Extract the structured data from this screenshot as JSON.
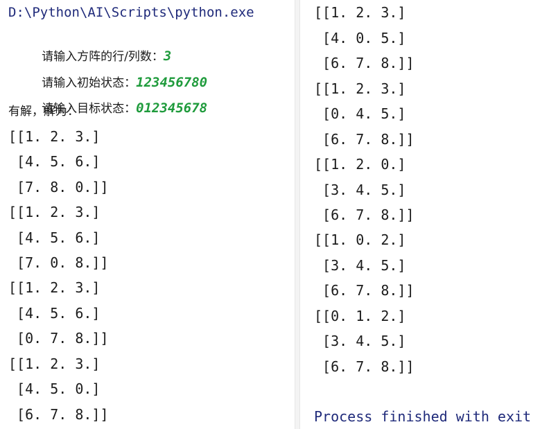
{
  "left": {
    "path": "D:\\Python\\AI\\Scripts\\python.exe",
    "prompt_size_label": "请输入方阵的行/列数：",
    "prompt_size_value": "3",
    "prompt_initial_label": "请输入初始状态：",
    "prompt_initial_value": "123456780",
    "prompt_target_label": "请输入目标状态：",
    "prompt_target_value": "012345678",
    "solution_label": "有解，解为：",
    "matrix_lines": [
      "[[1. 2. 3.]",
      " [4. 5. 6.]",
      " [7. 8. 0.]]",
      "[[1. 2. 3.]",
      " [4. 5. 6.]",
      " [7. 0. 8.]]",
      "[[1. 2. 3.]",
      " [4. 5. 6.]",
      " [0. 7. 8.]]",
      "[[1. 2. 3.]",
      " [4. 5. 0.]",
      " [6. 7. 8.]]"
    ]
  },
  "right": {
    "matrix_lines": [
      "[[1. 2. 3.]",
      " [4. 0. 5.]",
      " [6. 7. 8.]]",
      "[[1. 2. 3.]",
      " [0. 4. 5.]",
      " [6. 7. 8.]]",
      "[[1. 2. 0.]",
      " [3. 4. 5.]",
      " [6. 7. 8.]]",
      "[[1. 0. 2.]",
      " [3. 4. 5.]",
      " [6. 7. 8.]]",
      "[[0. 1. 2.]",
      " [3. 4. 5.]",
      " [6. 7. 8.]]"
    ],
    "process_text": "Process finished with exit"
  },
  "colors": {
    "text": "#1b1b1b",
    "path": "#1f2a7a",
    "input_value": "#1f9b3c",
    "divider": "#f3f3f3"
  }
}
